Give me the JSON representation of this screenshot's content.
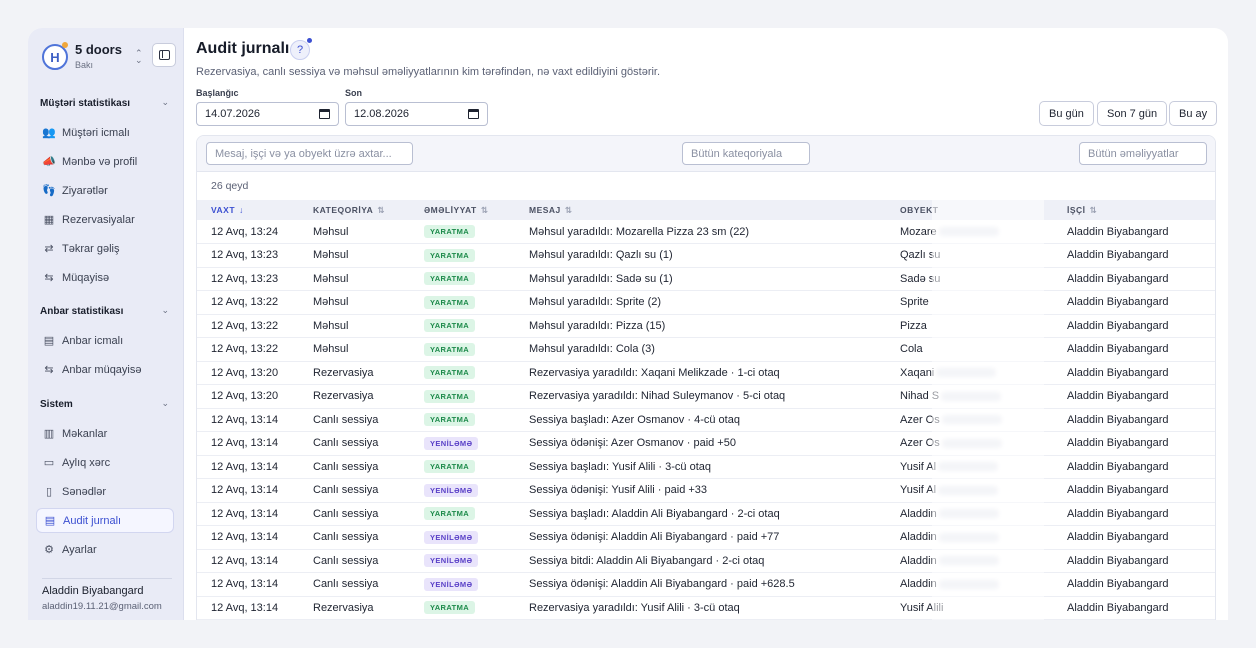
{
  "brand": {
    "name": "5 doors",
    "city": "Bakı",
    "logo_letter": "H",
    "switch_icon": "chevrons-updown-icon",
    "collapse_icon": "panel-collapse-icon"
  },
  "sidebar": {
    "sections": [
      {
        "title": "Müştəri statistikası",
        "chevron": "⌄",
        "items": [
          {
            "label": "Müştəri icmalı",
            "icon": "users-icon",
            "glyph": "👥"
          },
          {
            "label": "Mənbə və profil",
            "icon": "megaphone-icon",
            "glyph": "📣"
          },
          {
            "label": "Ziyarətlər",
            "icon": "footprints-icon",
            "glyph": "👣"
          },
          {
            "label": "Rezervasiyalar",
            "icon": "calendar-icon",
            "glyph": "▦"
          },
          {
            "label": "Təkrar gəliş",
            "icon": "repeat-icon",
            "glyph": "⇄"
          },
          {
            "label": "Müqayisə",
            "icon": "compare-icon",
            "glyph": "⇆"
          }
        ]
      },
      {
        "title": "Anbar statistikası",
        "chevron": "⌄",
        "items": [
          {
            "label": "Anbar icmalı",
            "icon": "warehouse-icon",
            "glyph": "▤"
          },
          {
            "label": "Anbar müqayisə",
            "icon": "compare-icon",
            "glyph": "⇆"
          }
        ]
      },
      {
        "title": "Sistem",
        "chevron": "⌄",
        "items": [
          {
            "label": "Məkanlar",
            "icon": "building-icon",
            "glyph": "▥"
          },
          {
            "label": "Aylıq xərc",
            "icon": "credit-card-icon",
            "glyph": "▭"
          },
          {
            "label": "Sənədlər",
            "icon": "document-icon",
            "glyph": "▯"
          },
          {
            "label": "Audit jurnalı",
            "icon": "audit-log-icon",
            "glyph": "▤",
            "active": true
          },
          {
            "label": "Ayarlar",
            "icon": "gear-icon",
            "glyph": "⚙"
          }
        ]
      }
    ]
  },
  "user": {
    "name": "Aladdin Biyabangard",
    "email": "aladdin19.11.21@gmail.com"
  },
  "page": {
    "title": "Audit jurnalı",
    "help_glyph": "?",
    "subtitle": "Rezervasiya, canlı sessiya və məhsul əməliyyatlarının kim tərəfindən, nə vaxt edildiyini göstərir."
  },
  "filters": {
    "start_label": "Başlanğıc",
    "start_value": "14.07.2026",
    "end_label": "Son",
    "end_value": "12.08.2026",
    "quick": [
      "Bu gün",
      "Son 7 gün",
      "Bu ay"
    ]
  },
  "toolbar": {
    "search_placeholder": "Mesaj, işçi və ya obyekt üzrə axtar...",
    "category_value": "Bütün kateqoriyala",
    "action_value": "Bütün əməliyyatlar"
  },
  "table": {
    "count": "26 qeyd",
    "headers": [
      "VAXT",
      "KATEQORİYA",
      "ƏMƏLİYYAT",
      "MESAJ",
      "OBYEKT",
      "İŞÇİ"
    ],
    "sort_active": "↓",
    "sort_idle": "⇅",
    "rows": [
      {
        "time": "12 Avq, 13:24",
        "category": "Məhsul",
        "action": "YARATMA",
        "type": "create",
        "message": "Məhsul yaradıldı: Mozarella Pizza 23 sm (22)",
        "object": "Mozare",
        "blur": true,
        "user": "Aladdin Biyabangard"
      },
      {
        "time": "12 Avq, 13:23",
        "category": "Məhsul",
        "action": "YARATMA",
        "type": "create",
        "message": "Məhsul yaradıldı: Qazlı su (1)",
        "object": "Qazlı su",
        "blur": false,
        "user": "Aladdin Biyabangard"
      },
      {
        "time": "12 Avq, 13:23",
        "category": "Məhsul",
        "action": "YARATMA",
        "type": "create",
        "message": "Məhsul yaradıldı: Sadə su (1)",
        "object": "Sadə su",
        "blur": false,
        "user": "Aladdin Biyabangard"
      },
      {
        "time": "12 Avq, 13:22",
        "category": "Məhsul",
        "action": "YARATMA",
        "type": "create",
        "message": "Məhsul yaradıldı: Sprite (2)",
        "object": "Sprite",
        "blur": false,
        "user": "Aladdin Biyabangard"
      },
      {
        "time": "12 Avq, 13:22",
        "category": "Məhsul",
        "action": "YARATMA",
        "type": "create",
        "message": "Məhsul yaradıldı: Pizza (15)",
        "object": "Pizza",
        "blur": false,
        "user": "Aladdin Biyabangard"
      },
      {
        "time": "12 Avq, 13:22",
        "category": "Məhsul",
        "action": "YARATMA",
        "type": "create",
        "message": "Məhsul yaradıldı: Cola (3)",
        "object": "Cola",
        "blur": false,
        "user": "Aladdin Biyabangard"
      },
      {
        "time": "12 Avq, 13:20",
        "category": "Rezervasiya",
        "action": "YARATMA",
        "type": "create",
        "message": "Rezervasiya yaradıldı: Xaqani Melikzade · 1-ci otaq",
        "object": "Xaqani",
        "blur": true,
        "user": "Aladdin Biyabangard"
      },
      {
        "time": "12 Avq, 13:20",
        "category": "Rezervasiya",
        "action": "YARATMA",
        "type": "create",
        "message": "Rezervasiya yaradıldı: Nihad Suleymanov · 5-ci otaq",
        "object": "Nihad S",
        "blur": true,
        "user": "Aladdin Biyabangard"
      },
      {
        "time": "12 Avq, 13:14",
        "category": "Canlı sessiya",
        "action": "YARATMA",
        "type": "create",
        "message": "Sessiya başladı: Azer Osmanov · 4-cü otaq",
        "object": "Azer Os",
        "blur": true,
        "user": "Aladdin Biyabangard"
      },
      {
        "time": "12 Avq, 13:14",
        "category": "Canlı sessiya",
        "action": "YENİLƏMƏ",
        "type": "update",
        "message": "Sessiya ödənişi: Azer Osmanov · paid +50",
        "object": "Azer Os",
        "blur": true,
        "user": "Aladdin Biyabangard"
      },
      {
        "time": "12 Avq, 13:14",
        "category": "Canlı sessiya",
        "action": "YARATMA",
        "type": "create",
        "message": "Sessiya başladı: Yusif Alili · 3-cü otaq",
        "object": "Yusif Al",
        "blur": true,
        "user": "Aladdin Biyabangard"
      },
      {
        "time": "12 Avq, 13:14",
        "category": "Canlı sessiya",
        "action": "YENİLƏMƏ",
        "type": "update",
        "message": "Sessiya ödənişi: Yusif Alili · paid +33",
        "object": "Yusif Al",
        "blur": true,
        "user": "Aladdin Biyabangard"
      },
      {
        "time": "12 Avq, 13:14",
        "category": "Canlı sessiya",
        "action": "YARATMA",
        "type": "create",
        "message": "Sessiya başladı: Aladdin Ali Biyabangard · 2-ci otaq",
        "object": "Aladdin",
        "blur": true,
        "user": "Aladdin Biyabangard"
      },
      {
        "time": "12 Avq, 13:14",
        "category": "Canlı sessiya",
        "action": "YENİLƏMƏ",
        "type": "update",
        "message": "Sessiya ödənişi: Aladdin Ali Biyabangard · paid +77",
        "object": "Aladdin",
        "blur": true,
        "user": "Aladdin Biyabangard"
      },
      {
        "time": "12 Avq, 13:14",
        "category": "Canlı sessiya",
        "action": "YENİLƏMƏ",
        "type": "update",
        "message": "Sessiya bitdi: Aladdin Ali Biyabangard · 2-ci otaq",
        "object": "Aladdin",
        "blur": true,
        "user": "Aladdin Biyabangard"
      },
      {
        "time": "12 Avq, 13:14",
        "category": "Canlı sessiya",
        "action": "YENİLƏMƏ",
        "type": "update",
        "message": "Sessiya ödənişi: Aladdin Ali Biyabangard · paid +628.5",
        "object": "Aladdin",
        "blur": true,
        "user": "Aladdin Biyabangard"
      },
      {
        "time": "12 Avq, 13:14",
        "category": "Rezervasiya",
        "action": "YARATMA",
        "type": "create",
        "message": "Rezervasiya yaradıldı: Yusif Alili · 3-cü otaq",
        "object": "Yusif Alili",
        "blur": false,
        "user": "Aladdin Biyabangard"
      }
    ]
  },
  "colors": {
    "accent": "#3b4fd1",
    "create_bg": "#dcf5e6",
    "create_fg": "#1c8a4a",
    "update_bg": "#e9e4fb",
    "update_fg": "#5a40c7",
    "sidebar_bg": "#e9ebf6"
  }
}
